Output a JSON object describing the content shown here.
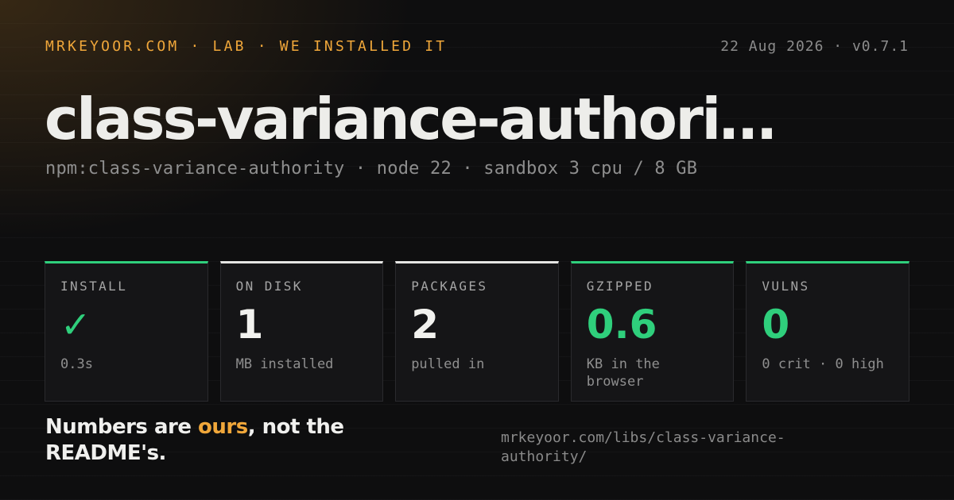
{
  "header": {
    "kicker": "MRKEYOOR.COM · LAB · WE INSTALLED IT",
    "meta": "22 Aug 2026 · v0.7.1"
  },
  "title": "class-variance-authori…",
  "subtitle": "npm:class-variance-authority · node 22 · sandbox 3 cpu / 8 GB",
  "cards": [
    {
      "label": "INSTALL",
      "value": "✓",
      "sub": "0.3s",
      "accent": "green",
      "icon": "checkmark-icon"
    },
    {
      "label": "ON DISK",
      "value": "1",
      "sub": "MB installed",
      "accent": "white"
    },
    {
      "label": "PACKAGES",
      "value": "2",
      "sub": "pulled in",
      "accent": "white"
    },
    {
      "label": "GZIPPED",
      "value": "0.6",
      "sub": "KB in the browser",
      "accent": "green"
    },
    {
      "label": "VULNS",
      "value": "0",
      "sub": "0 crit · 0 high",
      "accent": "green"
    }
  ],
  "tagline": {
    "before": "Numbers are ",
    "highlight": "ours",
    "after": ", not the README's."
  },
  "url": "mrkeyoor.com/libs/class-variance-authority/",
  "colors": {
    "accent_orange": "#f0a73a",
    "accent_green": "#2fcf7c",
    "background": "#0e0e0f",
    "card_background": "#151517"
  }
}
